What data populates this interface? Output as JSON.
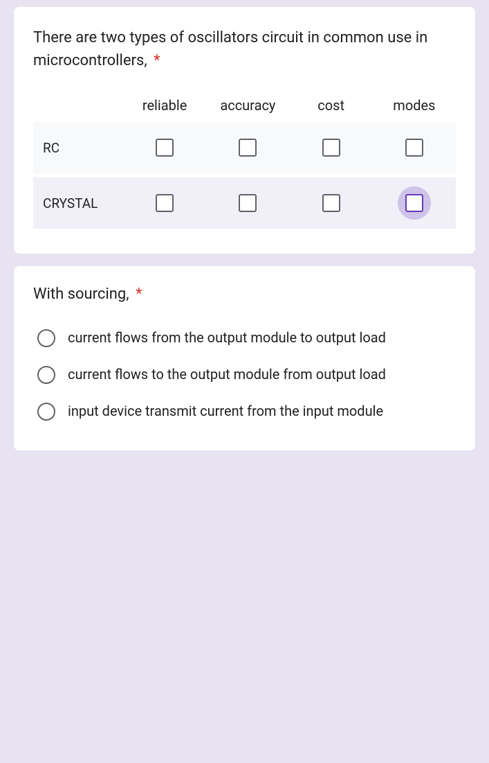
{
  "q1": {
    "title": "There are two types of oscillators circuit in common use in microcontrollers,",
    "required": "*",
    "columns": [
      "reliable",
      "accuracy",
      "cost",
      "modes"
    ],
    "rows": [
      "RC",
      "CRYSTAL"
    ]
  },
  "q2": {
    "title": "With sourcing,",
    "required": "*",
    "options": [
      "current flows from the output module to output load",
      "current flows to the output module from output load",
      "input device transmit current from the input module"
    ]
  }
}
